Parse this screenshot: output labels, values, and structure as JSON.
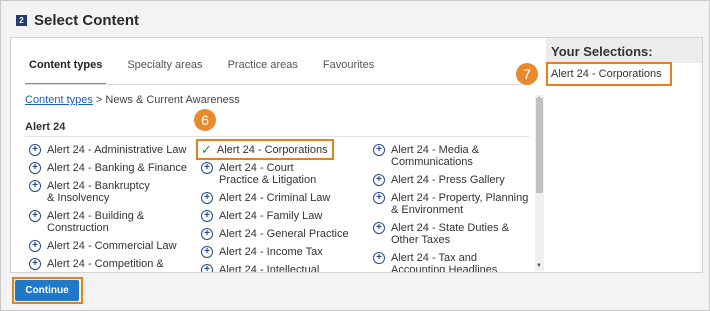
{
  "header": {
    "step": "2",
    "title": "Select Content"
  },
  "tabs": [
    {
      "label": "Content types",
      "active": true
    },
    {
      "label": "Specialty areas",
      "active": false
    },
    {
      "label": "Practice areas",
      "active": false
    },
    {
      "label": "Favourites",
      "active": false
    }
  ],
  "breadcrumb": {
    "link": "Content types",
    "rest": " > News & Current Awareness"
  },
  "section_title": "Alert 24",
  "columns": {
    "col1": [
      "Alert 24 - Administrative Law",
      "Alert 24 - Banking & Finance",
      "Alert 24 - Bankruptcy & Insolvency",
      "Alert 24 - Building & Construction",
      "Alert 24 - Commercial Law",
      "Alert 24 - Competition &"
    ],
    "col2": [
      "Alert 24 - Corporations",
      "Alert 24 - Court Practice & Litigation",
      "Alert 24 - Criminal Law",
      "Alert 24 - Family Law",
      "Alert 24 - General Practice",
      "Alert 24 - Income Tax",
      "Alert 24 - Intellectual"
    ],
    "col3": [
      "Alert 24 - Media & Communications",
      "Alert 24 - Press Gallery",
      "Alert 24 - Property, Planning & Environment",
      "Alert 24 - State Duties & Other Taxes",
      "Alert 24 - Tax and Accounting Headlines"
    ]
  },
  "selections": {
    "heading": "Your Selections:",
    "items": [
      "Alert 24 - Corporations"
    ]
  },
  "callouts": {
    "six": "6",
    "seven": "7"
  },
  "continue_label": "Continue",
  "colors": {
    "accent": "#e87f1e",
    "brand": "#1f78c8",
    "check": "#2e8b3a"
  },
  "icons": {
    "add": "plus-circle-icon",
    "selected": "checkmark-icon"
  }
}
